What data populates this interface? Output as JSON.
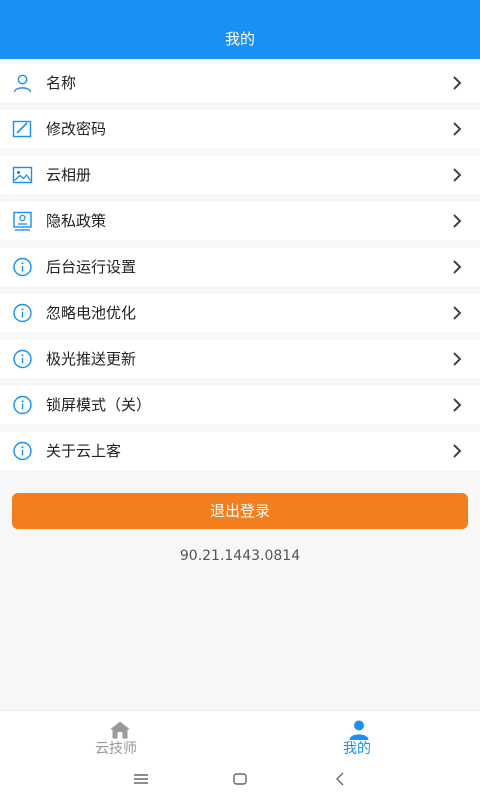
{
  "header": {
    "title": "我的"
  },
  "menu": {
    "items": [
      {
        "label": "名称",
        "icon": "user-icon"
      },
      {
        "label": "修改密码",
        "icon": "edit-icon"
      },
      {
        "label": "云相册",
        "icon": "image-icon"
      },
      {
        "label": "隐私政策",
        "icon": "document-icon"
      },
      {
        "label": "后台运行设置",
        "icon": "info-icon"
      },
      {
        "label": "忽略电池优化",
        "icon": "info-icon"
      },
      {
        "label": "极光推送更新",
        "icon": "info-icon"
      },
      {
        "label": "锁屏模式（关）",
        "icon": "info-icon"
      },
      {
        "label": "关于云上客",
        "icon": "info-icon"
      }
    ]
  },
  "logout": {
    "label": "退出登录"
  },
  "version": {
    "text": "90.21.1443.0814"
  },
  "tabbar": {
    "tabs": [
      {
        "label": "云技师",
        "icon": "home-icon",
        "active": false
      },
      {
        "label": "我的",
        "icon": "person-icon",
        "active": true
      }
    ]
  },
  "colors": {
    "primary": "#1a90f5",
    "logout": "#f27f1f",
    "background": "#f7f7f7"
  }
}
